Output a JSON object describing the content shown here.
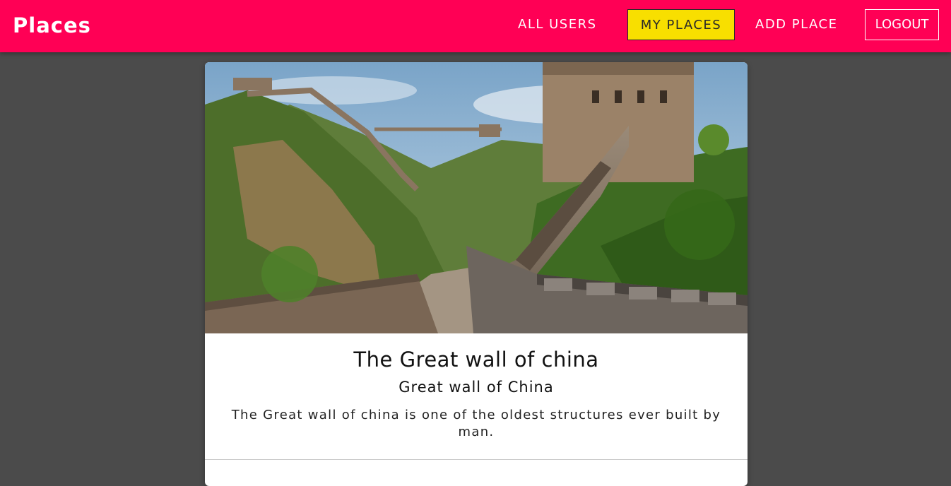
{
  "header": {
    "logo": "Places"
  },
  "nav": {
    "all_users": "ALL USERS",
    "my_places": "MY PLACES",
    "add_place": "ADD PLACE",
    "logout": "LOGOUT"
  },
  "place": {
    "title": "The Great wall of china",
    "address": "Great wall of China",
    "description": "The Great wall of china is one of the oldest structures ever built by man."
  },
  "colors": {
    "header_bg": "#ff0055",
    "active_nav_bg": "#f8df00",
    "page_bg": "#4b4b4b"
  }
}
